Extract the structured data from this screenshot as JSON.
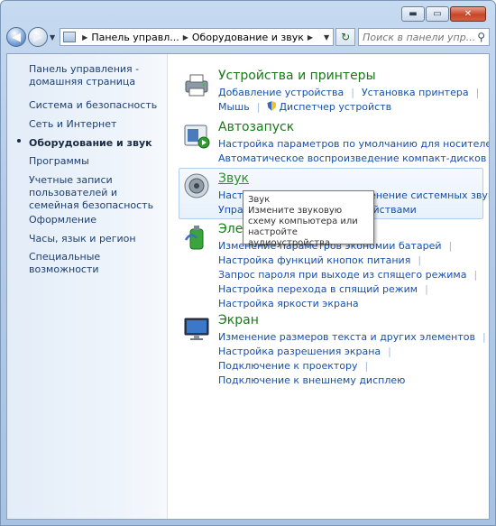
{
  "window": {
    "caption_buttons": {
      "minimize": "▬",
      "maximize": "▭",
      "close": "✕"
    }
  },
  "navbar": {
    "back_glyph": "◀",
    "forward_glyph": "▶",
    "breadcrumb": [
      "Панель управл...",
      "Оборудование и звук"
    ],
    "search_placeholder": "Поиск в панели упр..."
  },
  "sidebar": {
    "items": [
      {
        "label": "Панель управления - домашняя страница"
      },
      {
        "label": "Система и безопасность"
      },
      {
        "label": "Сеть и Интернет"
      },
      {
        "label": "Оборудование и звук",
        "active": true
      },
      {
        "label": "Программы"
      },
      {
        "label": "Учетные записи пользователей и семейная безопасность"
      },
      {
        "label": "Оформление"
      },
      {
        "label": "Часы, язык и регион"
      },
      {
        "label": "Специальные возможности"
      }
    ]
  },
  "categories": [
    {
      "title": "Устройства и принтеры",
      "icon": "printer-icon",
      "rows": [
        [
          "Добавление устройства",
          "Установка принтера"
        ],
        [
          "Мышь",
          "Диспетчер устройств"
        ]
      ]
    },
    {
      "title": "Автозапуск",
      "icon": "autoplay-icon",
      "rows": [
        [
          "Настройка параметров по умолчанию для носителей или"
        ],
        [
          "Автоматическое воспроизведение компакт-дисков или"
        ]
      ]
    },
    {
      "title": "Звук",
      "icon": "speaker-icon",
      "rows": [
        [
          "Настройка громкости",
          "Изменение системных звуков"
        ],
        [
          "Управление звуковыми устройствами"
        ]
      ]
    },
    {
      "title": "Электропитание",
      "icon": "power-icon",
      "rows": [
        [
          "Изменение параметров экономии батарей"
        ],
        [
          "Настройка функций кнопок питания"
        ],
        [
          "Запрос пароля при выходе из спящего режима"
        ],
        [
          "Настройка перехода в спящий режим"
        ],
        [
          "Настройка яркости экрана"
        ]
      ]
    },
    {
      "title": "Экран",
      "icon": "display-icon",
      "rows": [
        [
          "Изменение размеров текста и других элементов"
        ],
        [
          "Настройка разрешения экрана"
        ],
        [
          "Подключение к проектору"
        ],
        [
          "Подключение к внешнему дисплею"
        ]
      ]
    }
  ],
  "tooltip": {
    "title": "Звук",
    "text": "Измените звуковую схему компьютера или настройте аудиоустройства."
  },
  "colors": {
    "link": "#1750a8",
    "category_title": "#1a7a1a",
    "sidebar_text": "#1c3f73"
  }
}
